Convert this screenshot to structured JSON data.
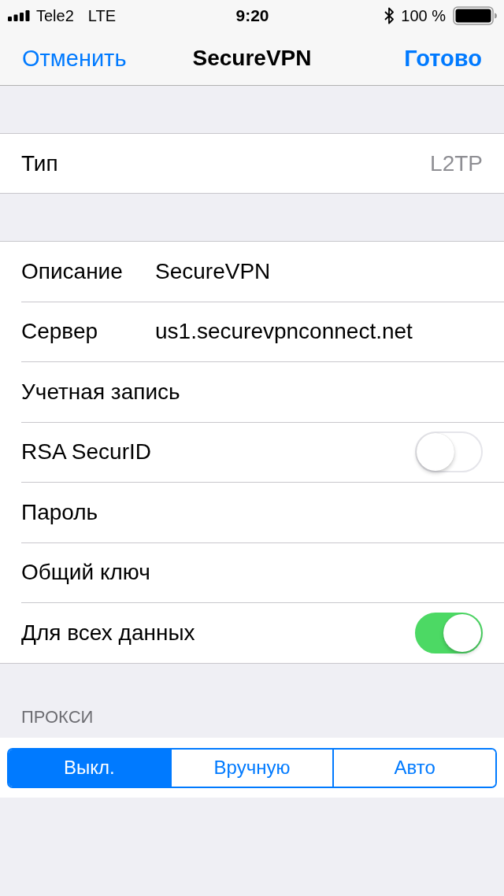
{
  "status_bar": {
    "carrier": "Tele2",
    "network": "LTE",
    "time": "9:20",
    "battery_text": "100 %"
  },
  "nav": {
    "cancel": "Отменить",
    "title": "SecureVPN",
    "done": "Готово"
  },
  "type_row": {
    "label": "Тип",
    "value": "L2TP"
  },
  "fields": [
    {
      "kind": "text",
      "label": "Описание",
      "value": "SecureVPN"
    },
    {
      "kind": "text",
      "label": "Сервер",
      "value": "us1.securevpnconnect.net"
    },
    {
      "kind": "text",
      "label": "Учетная запись"
    },
    {
      "kind": "toggle",
      "label": "RSA SecurID",
      "on": false
    },
    {
      "kind": "text",
      "label": "Пароль"
    },
    {
      "kind": "text",
      "label": "Общий ключ"
    },
    {
      "kind": "toggle",
      "label": "Для всех данных",
      "on": true
    }
  ],
  "proxy": {
    "header": "ПРОКСИ",
    "segments": [
      {
        "label": "Выкл.",
        "selected": true
      },
      {
        "label": "Вручную",
        "selected": false
      },
      {
        "label": "Авто",
        "selected": false
      }
    ]
  }
}
